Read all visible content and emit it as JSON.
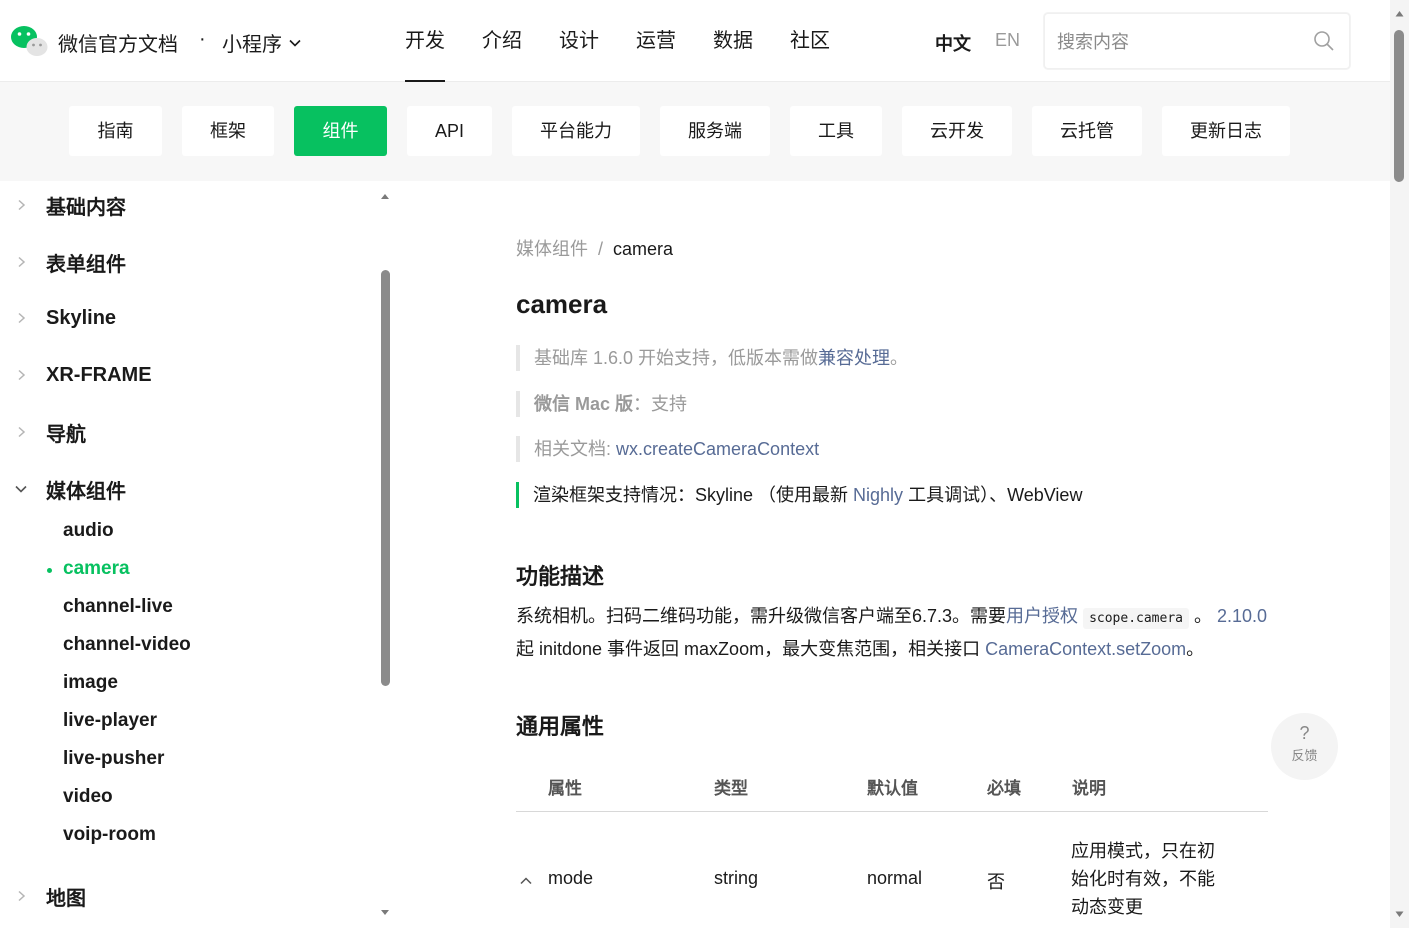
{
  "header": {
    "brand": "微信官方文档",
    "dot": "·",
    "sub_brand": "小程序",
    "nav": [
      {
        "label": "开发",
        "active": true
      },
      {
        "label": "介绍",
        "active": false
      },
      {
        "label": "设计",
        "active": false
      },
      {
        "label": "运营",
        "active": false
      },
      {
        "label": "数据",
        "active": false
      },
      {
        "label": "社区",
        "active": false
      }
    ],
    "lang_zh": "中文",
    "lang_en": "EN",
    "search_placeholder": "搜索内容"
  },
  "categories": [
    {
      "label": "指南"
    },
    {
      "label": "框架"
    },
    {
      "label": "组件",
      "active": true
    },
    {
      "label": "API"
    },
    {
      "label": "平台能力"
    },
    {
      "label": "服务端"
    },
    {
      "label": "工具"
    },
    {
      "label": "云开发"
    },
    {
      "label": "云托管"
    },
    {
      "label": "更新日志"
    }
  ],
  "sidebar": {
    "groups": [
      {
        "label": "基础内容"
      },
      {
        "label": "表单组件"
      },
      {
        "label": "Skyline"
      },
      {
        "label": "XR-FRAME"
      },
      {
        "label": "导航"
      },
      {
        "label": "媒体组件",
        "expanded": true
      },
      {
        "label": "地图"
      }
    ],
    "media_items": [
      {
        "label": "audio"
      },
      {
        "label": "camera",
        "active": true
      },
      {
        "label": "channel-live"
      },
      {
        "label": "channel-video"
      },
      {
        "label": "image"
      },
      {
        "label": "live-player"
      },
      {
        "label": "live-pusher"
      },
      {
        "label": "video"
      },
      {
        "label": "voip-room"
      }
    ]
  },
  "content": {
    "breadcrumb_parent": "媒体组件",
    "breadcrumb_sep": "/",
    "breadcrumb_current": "camera",
    "title": "camera",
    "note1_text": "基础库 1.6.0 开始支持，低版本需做",
    "note1_link": "兼容处理",
    "note1_end": "。",
    "note2_bold": "微信 Mac 版",
    "note2_text": "：支持",
    "note3_text": "相关文档: ",
    "note3_link": "wx.createCameraContext",
    "note4_text": "渲染框架支持情况：Skyline （使用最新 ",
    "note4_link": "Nighly",
    "note4_end": " 工具调试）、WebView",
    "section1": "功能描述",
    "desc_1": "系统相机。扫码二维码功能，需升级微信客户端至6.7.3。需要",
    "desc_link1": "用户授权",
    "desc_code": "scope.camera",
    "desc_2": " 。 ",
    "desc_link2": "2.10.0",
    "desc_3": "起 initdone 事件返回 maxZoom，最大变焦范围，相关接口 ",
    "desc_link3": "CameraContext.setZoom",
    "desc_4": "。",
    "section2": "通用属性",
    "table": {
      "headers": [
        "属性",
        "类型",
        "默认值",
        "必填",
        "说明"
      ],
      "row": {
        "name": "mode",
        "type": "string",
        "default": "normal",
        "required": "否",
        "desc": "应用模式，只在初始化时有效，不能动态变更"
      }
    }
  },
  "feedback": {
    "icon": "?",
    "label": "反馈"
  },
  "colors": {
    "accent": "#07c160",
    "link": "#576b95"
  }
}
